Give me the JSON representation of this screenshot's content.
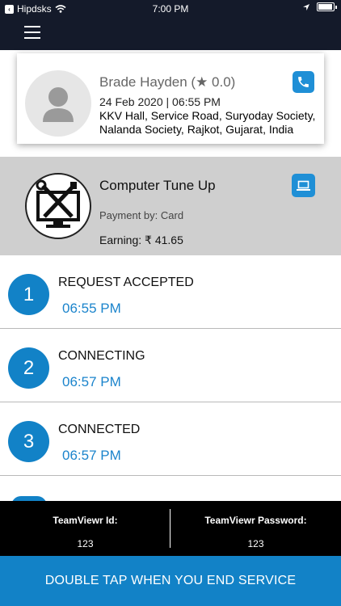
{
  "status_bar": {
    "carrier": "Hipdsks",
    "time": "7:00 PM"
  },
  "customer": {
    "name": "Brade Hayden (★ 0.0)",
    "datetime": "24 Feb 2020 | 06:55 PM",
    "address": "KKV Hall, Service Road, Suryoday Society, Nalanda Society, Rajkot, Gujarat, India"
  },
  "service": {
    "title": "Computer Tune Up",
    "payment": "Payment by: Card",
    "earning": "Earning: ₹ 41.65"
  },
  "steps": [
    {
      "number": "1",
      "label": "REQUEST ACCEPTED",
      "time": "06:55 PM"
    },
    {
      "number": "2",
      "label": "CONNECTING",
      "time": "06:57 PM"
    },
    {
      "number": "3",
      "label": "CONNECTED",
      "time": "06:57 PM"
    }
  ],
  "teamviewer": {
    "id_label": "TeamViewr Id:",
    "id_value": "123",
    "password_label": "TeamViewr Password:",
    "password_value": "123"
  },
  "end_button": "DOUBLE TAP WHEN YOU END SERVICE",
  "colors": {
    "header_bg": "#141a2a",
    "accent": "#1282c7",
    "button_blue": "#1f8fd6",
    "service_bg": "#cfcfcf"
  },
  "icons": {
    "menu": "hamburger-icon",
    "call": "phone-icon",
    "laptop": "laptop-icon",
    "avatar": "user-silhouette-icon",
    "service": "tools-monitor-icon"
  }
}
